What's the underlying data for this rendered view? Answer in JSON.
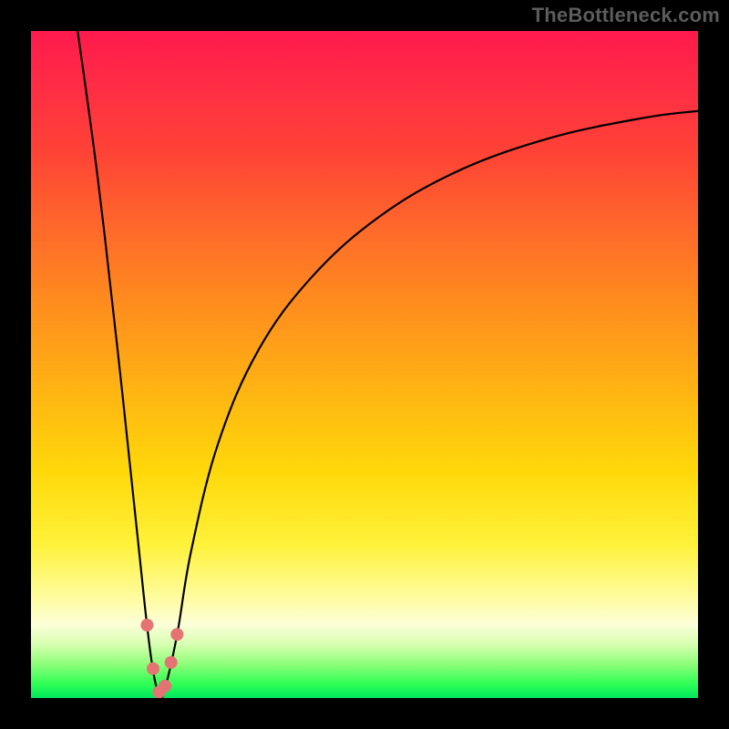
{
  "watermark": "TheBottleneck.com",
  "chart_data": {
    "type": "line",
    "title": "",
    "xlabel": "",
    "ylabel": "",
    "xlim": [
      0,
      100
    ],
    "ylim": [
      0,
      100
    ],
    "series": [
      {
        "name": "bottleneck-curve",
        "x": [
          7,
          10,
          13,
          16,
          17.5,
          18.5,
          19.5,
          20.5,
          22,
          24,
          28,
          34,
          42,
          52,
          64,
          78,
          92,
          100
        ],
        "y": [
          100,
          78,
          52,
          24,
          10,
          3,
          0,
          3,
          10,
          22,
          38,
          52,
          63,
          72,
          79,
          84,
          87,
          88
        ]
      }
    ],
    "marker_band": {
      "x_range": [
        16.5,
        23
      ],
      "y_max": 12,
      "color": "#e57373"
    },
    "gradient_stops": [
      {
        "pos": 0.0,
        "color": "#ff1a4d"
      },
      {
        "pos": 0.4,
        "color": "#ff8a1e"
      },
      {
        "pos": 0.7,
        "color": "#ffe23a"
      },
      {
        "pos": 0.88,
        "color": "#fdffcf"
      },
      {
        "pos": 1.0,
        "color": "#00e65c"
      }
    ]
  }
}
